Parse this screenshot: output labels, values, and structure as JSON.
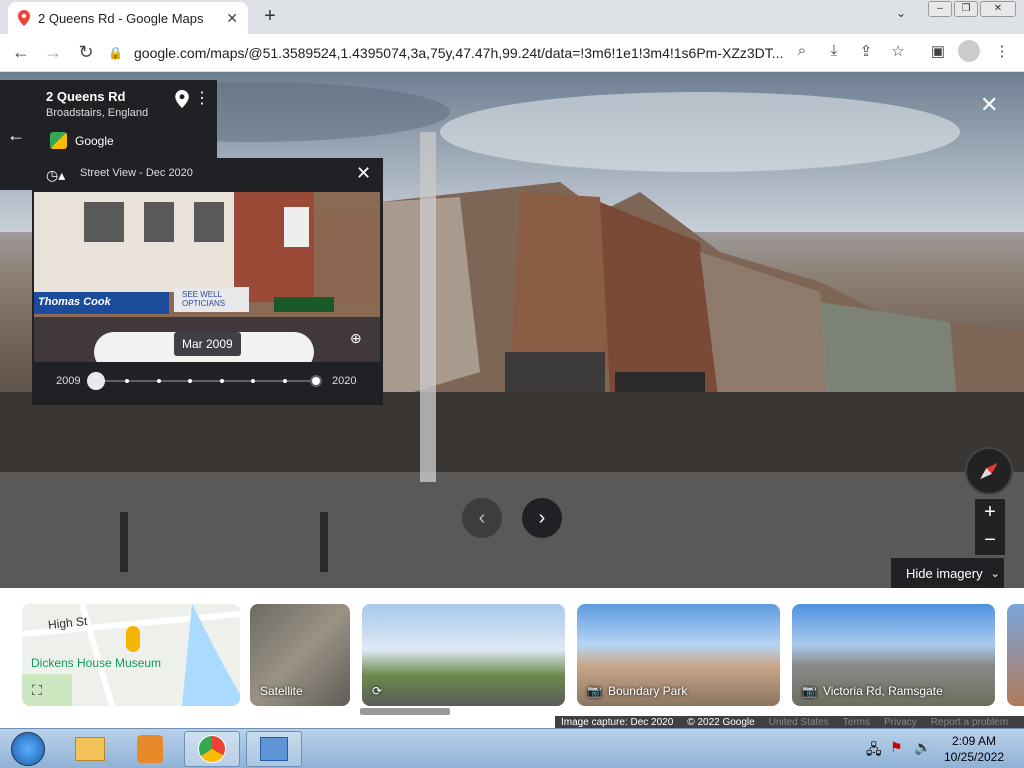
{
  "browser": {
    "tab_title": "2 Queens Rd - Google Maps",
    "tab_close": "✕",
    "new_tab": "+",
    "url": "google.com/maps/@51.3589524,1.4395074,3a,75y,47.47h,99.24t/data=!3m6!1e1!3m4!1s6Pm-XZz3DT..."
  },
  "place": {
    "name": "2 Queens Rd",
    "locality": "Broadstairs, England",
    "provider": "Google"
  },
  "time_machine": {
    "header": "Street View - Dec 2020",
    "thumb_date": "Mar 2009",
    "start_year": "2009",
    "end_year": "2020",
    "stops": 8,
    "selected_fraction": 0,
    "shop_sign_1": "Thomas Cook",
    "shop_sign_2": "SEE WELL OPTICIANS"
  },
  "controls": {
    "close": "✕",
    "zoom_in": "+",
    "zoom_out": "−",
    "hide_imagery": "Hide imagery"
  },
  "strip": {
    "map_card": {
      "street": "High St",
      "poi": "Dickens House Museum"
    },
    "satellite_label": "Satellite",
    "cards": [
      {
        "label": "Boundary Park"
      },
      {
        "label": "Victoria Rd, Ramsgate"
      }
    ]
  },
  "footer": {
    "image_capture": "Image capture: Dec 2020",
    "copyright": "© 2022 Google",
    "links": [
      "United States",
      "Terms",
      "Privacy",
      "Report a problem"
    ]
  },
  "taskbar": {
    "time": "2:09 AM",
    "date": "10/25/2022"
  },
  "colors": {
    "panel": "#202124",
    "map_green": "#34a853",
    "chrome_tabbar": "#dee1e6"
  }
}
